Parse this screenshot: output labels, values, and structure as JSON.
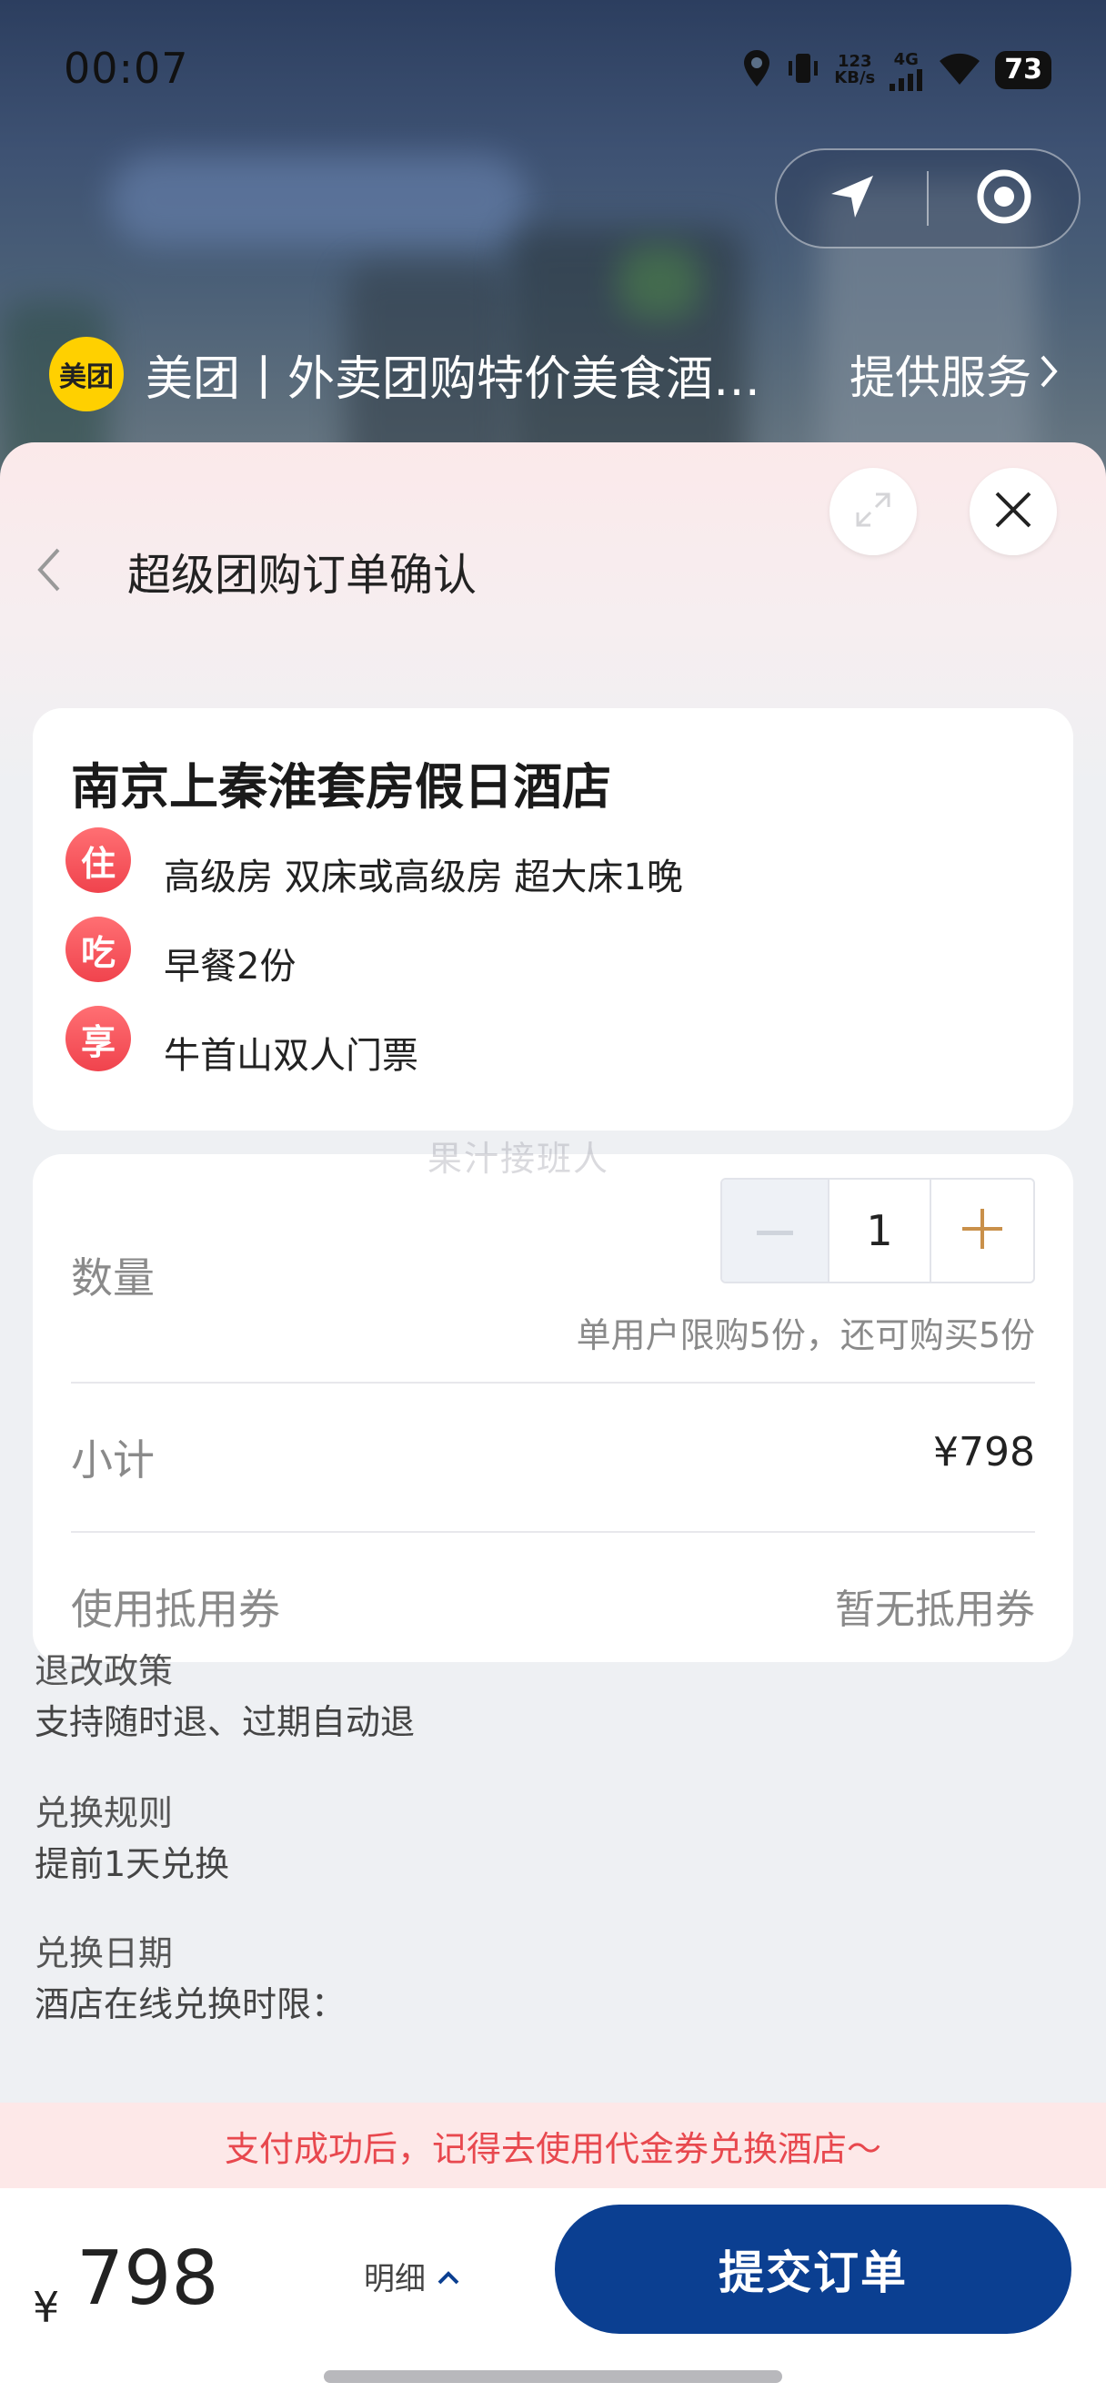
{
  "status_bar": {
    "time": "00:07",
    "speed_top": "123",
    "speed_bottom": "KB/s",
    "network": "4G",
    "battery": "73"
  },
  "service_banner": {
    "logo_text": "美团",
    "title": "美团丨外卖团购特价美食酒店电影",
    "link_label": "提供服务"
  },
  "sheet": {
    "title": "超级团购订单确认"
  },
  "hotel": {
    "name": "南京上秦淮套房假日酒店",
    "perks": [
      {
        "badge": "住",
        "text": "高级房 双床或高级房 超大床1晚"
      },
      {
        "badge": "吃",
        "text": "早餐2份"
      },
      {
        "badge": "享",
        "text": "牛首山双人门票"
      }
    ]
  },
  "watermark": "果汁接班人",
  "order": {
    "quantity_label": "数量",
    "quantity_value": "1",
    "limit_text": "单用户限购5份，还可购买5份",
    "subtotal_label": "小计",
    "subtotal_value": "¥798",
    "coupon_label": "使用抵用券",
    "coupon_value": "暂无抵用券"
  },
  "policies": [
    {
      "title": "退改政策",
      "text": "支持随时退、过期自动退"
    },
    {
      "title": "兑换规则",
      "text": "提前1天兑换"
    },
    {
      "title": "兑换日期",
      "text": "酒店在线兑换时限："
    }
  ],
  "notice": "支付成功后，记得去使用代金券兑换酒店～",
  "footer": {
    "currency": "¥",
    "price": "798",
    "detail_label": "明细",
    "submit_label": "提交订单"
  },
  "colors": {
    "accent_blue": "#0b3f91",
    "badge_red": "#f0434d",
    "notice_red": "#e8484e",
    "plus_gold": "#c9904a",
    "meituan_yellow": "#ffd000"
  },
  "icons": {
    "back": "chevron-left-icon",
    "close": "close-icon",
    "expand": "expand-icon",
    "location": "location-arrow-icon",
    "target": "target-icon",
    "minus": "minus-icon",
    "plus": "plus-icon",
    "detail": "chevron-up-icon"
  }
}
